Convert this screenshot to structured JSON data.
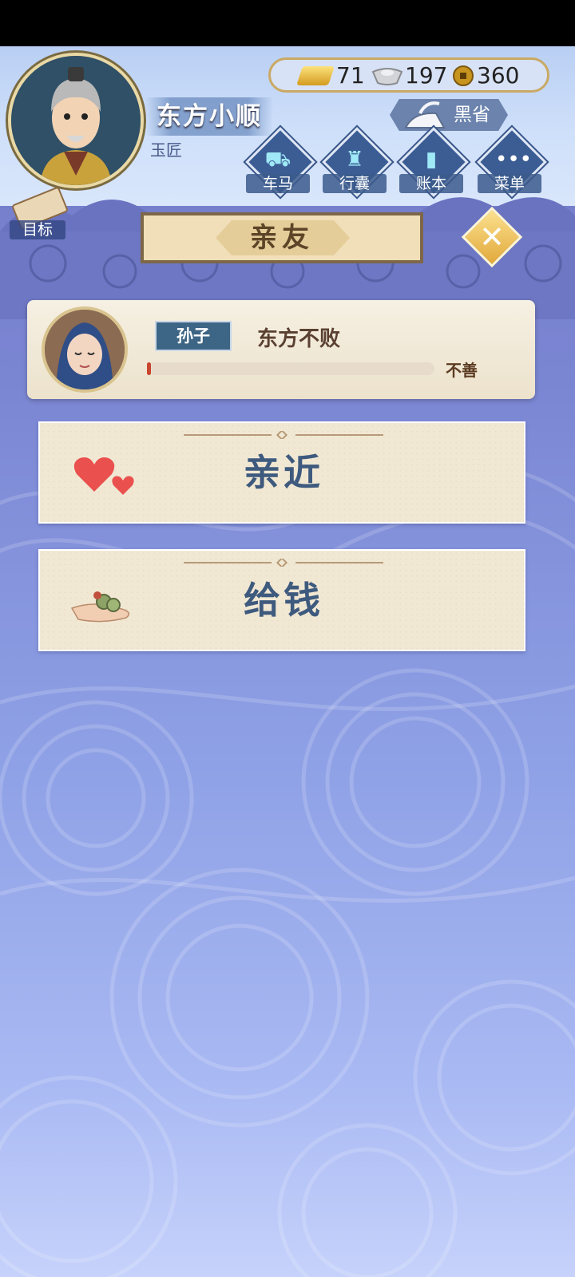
{
  "player": {
    "name": "东方小顺",
    "title": "玉匠"
  },
  "currency": {
    "gold": "71",
    "silver": "197",
    "copper": "360"
  },
  "region": "黑省",
  "nav": [
    {
      "label": "车马",
      "icon": "carriage-icon"
    },
    {
      "label": "行囊",
      "icon": "bag-icon"
    },
    {
      "label": "账本",
      "icon": "ledger-icon"
    },
    {
      "label": "菜单",
      "icon": "more-icon"
    }
  ],
  "goal_label": "目标",
  "section_title": "亲友",
  "relative": {
    "relation": "孙子",
    "name": "东方不败",
    "status": "不善",
    "affinity": 0.01
  },
  "actions": [
    {
      "label": "亲近",
      "icon": "hearts-icon"
    },
    {
      "label": "给钱",
      "icon": "coins-in-hand-icon"
    }
  ],
  "colors": {
    "accent": "#3e5a7e",
    "card": "#f1e8d4",
    "badge": "#3d6585",
    "bar_fill": "#c8452e"
  }
}
